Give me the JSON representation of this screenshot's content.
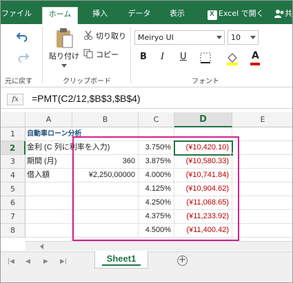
{
  "ribbon_tabs": [
    "ファイル",
    "ホーム",
    "挿入",
    "データ",
    "表示",
    "Excel で開く",
    "共"
  ],
  "ribbon": {
    "undo_group_label": "元に戻す",
    "paste_label": "貼り付け",
    "cut_label": "切り取り",
    "copy_label": "コピー",
    "clipboard_group_label": "クリップボード",
    "font_name": "Meiryo UI",
    "font_size": "10",
    "font_group_label": "フォント",
    "bold": "B",
    "italic": "I",
    "underline": "U",
    "font_color_letter": "A"
  },
  "formula_bar": {
    "fx": "fx",
    "formula": "=PMT(C2/12,$B$3,$B$4)"
  },
  "grid": {
    "columns": [
      "A",
      "B",
      "C",
      "D",
      "E"
    ],
    "rows": [
      "1",
      "2",
      "3",
      "4",
      "5",
      "6",
      "7",
      "8"
    ],
    "selected_column": "D",
    "selected_row": "2",
    "a1": "自動車ローン分析",
    "labels": [
      "金利 (C 列に利率を入力)",
      "期間 (月)",
      "借入額"
    ],
    "b3": "360",
    "b4": "¥2,250,00000",
    "rates": [
      "3.750%",
      "3.875%",
      "4.000%",
      "4.125%",
      "4.250%",
      "4.375%",
      "4.500%"
    ],
    "payments": [
      "(¥10,420.10)",
      "(¥10,580.33)",
      "(¥10,741.84)",
      "(¥10,904.62)",
      "(¥11,068.65)",
      "(¥11,233.92)",
      "(¥11,400.42)"
    ]
  },
  "sheet_tabs": [
    "Sheet1"
  ],
  "colors": {
    "accent": "#217346",
    "highlight_border": "#d4208c",
    "negative_text": "#c00000"
  }
}
